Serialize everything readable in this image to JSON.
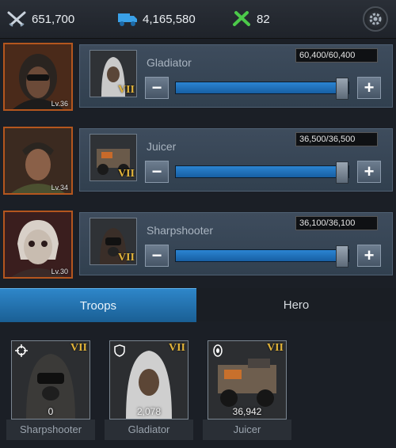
{
  "resources": {
    "power": {
      "icon": "crossed-swords-icon",
      "value": "651,700"
    },
    "load": {
      "icon": "truck-icon",
      "value": "4,165,580"
    },
    "repair": {
      "icon": "crossed-tools-icon",
      "value": "82"
    }
  },
  "rows": [
    {
      "hero_level": "Lv.36",
      "unit_name": "Gladiator",
      "tier": "VII",
      "count": "60,400/60,400",
      "slider_fraction": 1.0
    },
    {
      "hero_level": "Lv.34",
      "unit_name": "Juicer",
      "tier": "VII",
      "count": "36,500/36,500",
      "slider_fraction": 1.0
    },
    {
      "hero_level": "Lv.30",
      "unit_name": "Sharpshooter",
      "tier": "VII",
      "count": "36,100/36,100",
      "slider_fraction": 1.0
    }
  ],
  "tabs": {
    "troops": "Troops",
    "hero": "Hero",
    "active": "troops"
  },
  "troop_cards": [
    {
      "name": "Sharpshooter",
      "tier": "VII",
      "quantity": "0",
      "type_icon": "crosshair-icon"
    },
    {
      "name": "Gladiator",
      "tier": "VII",
      "quantity": "2,078",
      "type_icon": "shield-icon"
    },
    {
      "name": "Juicer",
      "tier": "VII",
      "quantity": "36,942",
      "type_icon": "wheel-icon"
    }
  ],
  "colors": {
    "accent_blue": "#2e86c9",
    "tier_gold": "#e2b43a",
    "portrait_border": "#b4561e"
  }
}
